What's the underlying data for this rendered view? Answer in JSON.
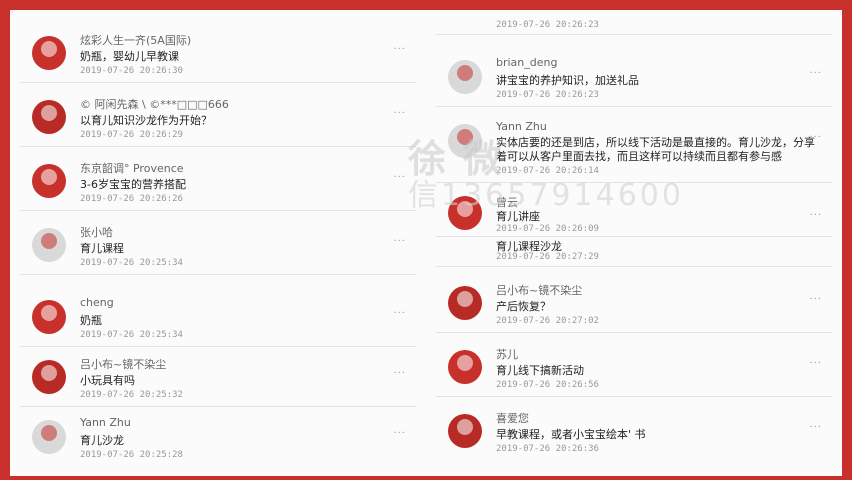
{
  "left_column": [
    {
      "name": "炫彩人生一齐(5A国际)",
      "message": "奶瓶，婴幼儿早教课",
      "time": "2019-07-26 20:26:30"
    },
    {
      "name": "© 阿闲先森 \\ ©***□□□666",
      "message": "以育儿知识沙龙作为开始？",
      "time": "2019-07-26 20:26:29"
    },
    {
      "name": "东京韶调° Provence",
      "message": "3-6岁宝宝的营养搭配",
      "time": "2019-07-26 20:26:26"
    },
    {
      "name": "张小哈",
      "message": "育儿课程",
      "time": "2019-07-26 20:25:34"
    },
    {
      "name": "cheng",
      "message": "奶瓶",
      "time": "2019-07-26 20:25:34"
    },
    {
      "name": "吕小布~镜不染尘",
      "message": "小玩具有吗",
      "time": "2019-07-26 20:25:32"
    },
    {
      "name": "Yann Zhu",
      "message": "育儿沙龙",
      "time": "2019-07-26 20:25:28"
    }
  ],
  "right_column": {
    "top_partial_time": "2019-07-26 20:26:23",
    "items": [
      {
        "name": "brian_deng",
        "message": "讲宝宝的养护知识，加送礼品",
        "time": "2019-07-26 20:26:23"
      },
      {
        "name": "Yann Zhu",
        "message": "实体店要的还是到店，所以线下活动是最直接的。育儿沙龙，分享着可以从客户里面去找，而且这样可以持续而且都有参与感",
        "time": "2019-07-26 20:26:14"
      },
      {
        "name": "曾云",
        "message": "育儿讲座",
        "time": "2019-07-26 20:26:09"
      },
      {
        "name": "",
        "message": "育儿课程沙龙",
        "time": "2019-07-26 20:27:29"
      },
      {
        "name": "吕小布~镜不染尘",
        "message": "产后恢复？",
        "time": "2019-07-26 20:27:02"
      },
      {
        "name": "苏儿",
        "message": "育儿线下搞新活动",
        "time": "2019-07-26 20:26:56"
      },
      {
        "name": "喜爱您",
        "message": "早教课程，或者小宝宝绘本' 书",
        "time": "2019-07-26 20:26:36"
      }
    ]
  },
  "more_glyph": "···",
  "watermark": {
    "line1": "徐 微",
    "line2": "信13657914600"
  }
}
